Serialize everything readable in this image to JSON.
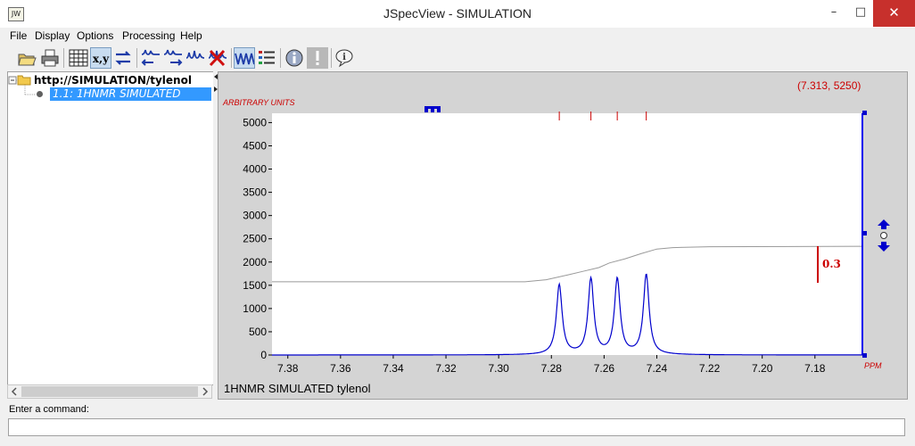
{
  "window": {
    "title": "JSpecView - SIMULATION",
    "app_icon_text": "JW",
    "minimize": "–",
    "maximize": "□",
    "close": "✕"
  },
  "menu": [
    "File",
    "Display",
    "Options",
    "Processing",
    "Help"
  ],
  "toolbar": {
    "icons": [
      "open-icon",
      "print-icon",
      "grid-icon",
      "coordinates-icon",
      "reverse-icon",
      "overlay-icon",
      "split-icon",
      "integrate-icon",
      "delete-icon",
      "spectrum-icon",
      "list-icon",
      "info-icon",
      "exclamation-icon",
      "help-icon"
    ],
    "xy_label": "x,y",
    "active": [
      "coordinates",
      "spectrum"
    ]
  },
  "tree": {
    "root": "http://SIMULATION/tylenol",
    "child": "1.1: 1HNMR SIMULATED tylenol"
  },
  "spectrum": {
    "coord_readout": "(7.313, 5250)",
    "y_unit": "ARBITRARY UNITS",
    "x_unit": "PPM",
    "title": "1HNMR SIMULATED tylenol",
    "integral_label": "0.3",
    "peak_marks_ppm": [
      7.277,
      7.265,
      7.255,
      7.244
    ]
  },
  "chart_data": {
    "type": "line",
    "title": "1HNMR SIMULATED tylenol",
    "xlabel": "PPM",
    "ylabel": "ARBITRARY UNITS",
    "xlim": [
      7.386,
      7.162
    ],
    "ylim": [
      0,
      5200
    ],
    "x_reversed": true,
    "x_ticks": [
      "7.38",
      "7.36",
      "7.34",
      "7.32",
      "7.30",
      "7.28",
      "7.26",
      "7.24",
      "7.22",
      "7.20",
      "7.18"
    ],
    "y_ticks": [
      "0",
      "500",
      "1000",
      "1500",
      "2000",
      "2500",
      "3000",
      "3500",
      "4000",
      "4500",
      "5000"
    ],
    "series": [
      {
        "color": "#0000cc",
        "peaks": [
          {
            "x": 7.277,
            "y": 1500
          },
          {
            "x": 7.265,
            "y": 1620
          },
          {
            "x": 7.255,
            "y": 1620
          },
          {
            "x": 7.244,
            "y": 1720
          }
        ]
      },
      {
        "color": "#999999",
        "integral_points": [
          [
            7.386,
            1575
          ],
          [
            7.29,
            1575
          ],
          [
            7.282,
            1620
          ],
          [
            7.274,
            1720
          ],
          [
            7.268,
            1800
          ],
          [
            7.262,
            1880
          ],
          [
            7.258,
            1980
          ],
          [
            7.252,
            2070
          ],
          [
            7.246,
            2180
          ],
          [
            7.24,
            2280
          ],
          [
            7.234,
            2310
          ],
          [
            7.22,
            2330
          ],
          [
            7.162,
            2340
          ]
        ]
      }
    ],
    "grid": false
  },
  "command": {
    "label": "Enter a command:",
    "value": ""
  }
}
